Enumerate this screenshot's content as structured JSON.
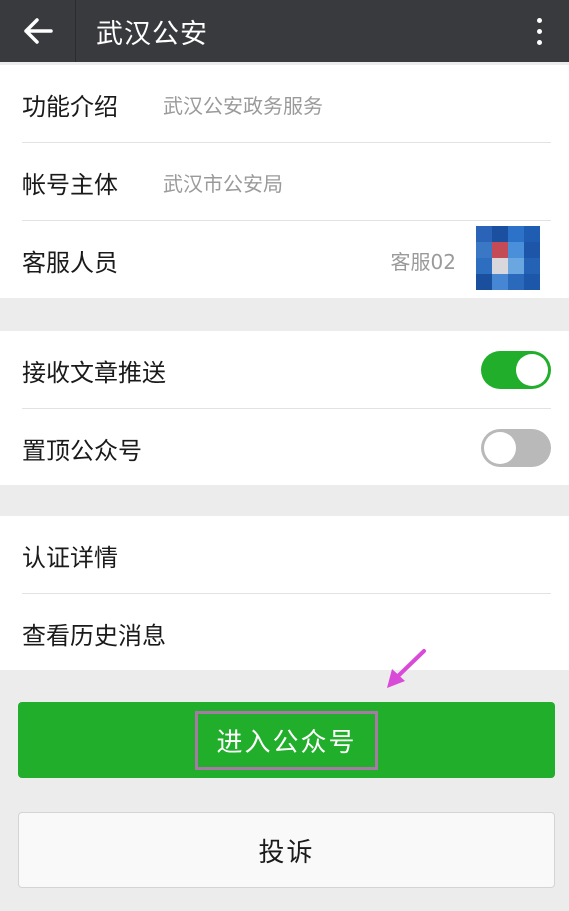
{
  "header": {
    "title": "武汉公安",
    "back_icon": "arrow-left-icon",
    "more_icon": "more-vertical-icon"
  },
  "info": {
    "intro_label": "功能介绍",
    "intro_value": "武汉公安政务服务",
    "account_label": "帐号主体",
    "account_value": "武汉市公安局",
    "cs_label": "客服人员",
    "cs_value": "客服02"
  },
  "settings": {
    "push_label": "接收文章推送",
    "push_on": true,
    "pin_label": "置顶公众号",
    "pin_on": false
  },
  "more": {
    "verify_label": "认证详情",
    "history_label": "查看历史消息"
  },
  "actions": {
    "enter_label": "进入公众号",
    "complain_label": "投诉"
  },
  "colors": {
    "topbar": "#393a3e",
    "accent_green": "#21ae2b",
    "highlight_box": "#a77aa6",
    "annotation_arrow": "#d94ad9"
  }
}
